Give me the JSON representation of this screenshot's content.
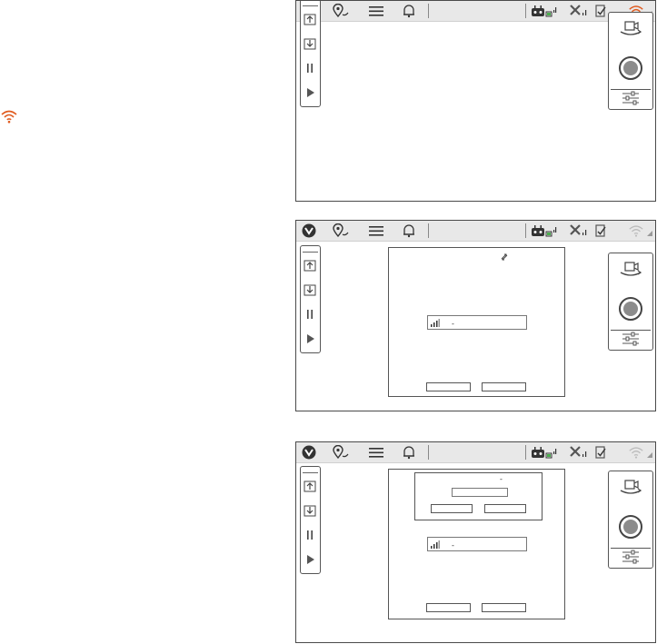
{
  "colors": {
    "accent": "#e05a1e",
    "topbar": "#e8e8e8",
    "frame": "#4a4a4a",
    "record_fill": "#8c8c8c",
    "muted": "#b5b5b5"
  },
  "topbar_icons": [
    "brand-logo-icon",
    "map-pin-icon",
    "menu-icon",
    "bell-icon",
    "controller-battery-icon",
    "satellite-signal-icon",
    "device-check-icon",
    "wifi-icon"
  ],
  "left_panel_icons": [
    "upload-icon",
    "download-icon",
    "pause-icon",
    "play-icon"
  ],
  "right_panel_icons": [
    "camera-switch-icon",
    "record-button-icon",
    "settings-sliders-icon"
  ],
  "screens": [
    {
      "wifi_status": "active"
    },
    {
      "wifi_status": "inactive",
      "dialog": {
        "signal_value": "-",
        "buttons": [
          "",
          ""
        ]
      }
    },
    {
      "wifi_status": "inactive",
      "dialog": {
        "signal_value": "-",
        "buttons": [
          "",
          ""
        ],
        "sub_dialog": {
          "text": "-",
          "buttons": [
            "",
            ""
          ]
        }
      }
    }
  ],
  "dialog_text": {
    "dash": "-"
  }
}
